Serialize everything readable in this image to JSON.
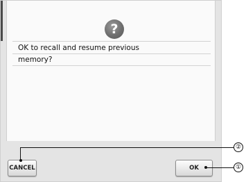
{
  "dialog": {
    "icon": "question-icon",
    "icon_glyph": "?",
    "message_line1": "OK to recall and resume previous",
    "message_line2": "memory?"
  },
  "buttons": {
    "cancel_label": "CANCEL",
    "ok_label": "OK"
  },
  "callouts": {
    "ok_marker": "①",
    "cancel_marker": "②"
  },
  "colors": {
    "panel_bg": "#e4e4e4",
    "dialog_bg": "#fafafa",
    "icon_bg": "#6e6e6e"
  }
}
